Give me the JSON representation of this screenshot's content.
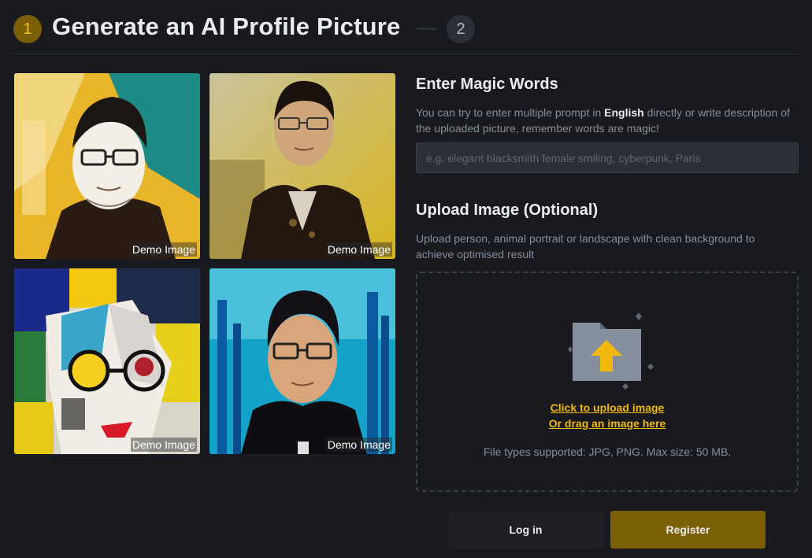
{
  "header": {
    "step1": "1",
    "title": "Generate an AI Profile Picture",
    "step2": "2"
  },
  "gallery": {
    "items": [
      {
        "label": "Demo Image",
        "style": "sketch-yellow-teal"
      },
      {
        "label": "Demo Image",
        "style": "oil-portrait-gold"
      },
      {
        "label": "Demo Image",
        "style": "cubist-colorful"
      },
      {
        "label": "Demo Image",
        "style": "cyber-blue"
      }
    ]
  },
  "prompt": {
    "heading": "Enter Magic Words",
    "desc_before": "You can try to enter multiple prompt in ",
    "desc_emph": "English",
    "desc_after": " directly or write description of the uploaded picture, remember words are magic!",
    "placeholder": "e.g. elegant blacksmith female smiling, cyberpunk, Paris",
    "value": ""
  },
  "upload": {
    "heading": "Upload Image (Optional)",
    "desc": "Upload person, animal portrait or landscape with clean background to achieve optimised result",
    "click_label": "Click to upload image",
    "drag_label": "Or drag an image here",
    "filetypes": "File types supported: JPG, PNG. Max size: 50 MB.",
    "icon": "folder-upload-icon"
  },
  "actions": {
    "login": "Log in",
    "register": "Register"
  },
  "colors": {
    "background": "#181a20",
    "accent": "#f0b90b",
    "accent_dark": "#7a5f06",
    "muted": "#848e9c"
  }
}
